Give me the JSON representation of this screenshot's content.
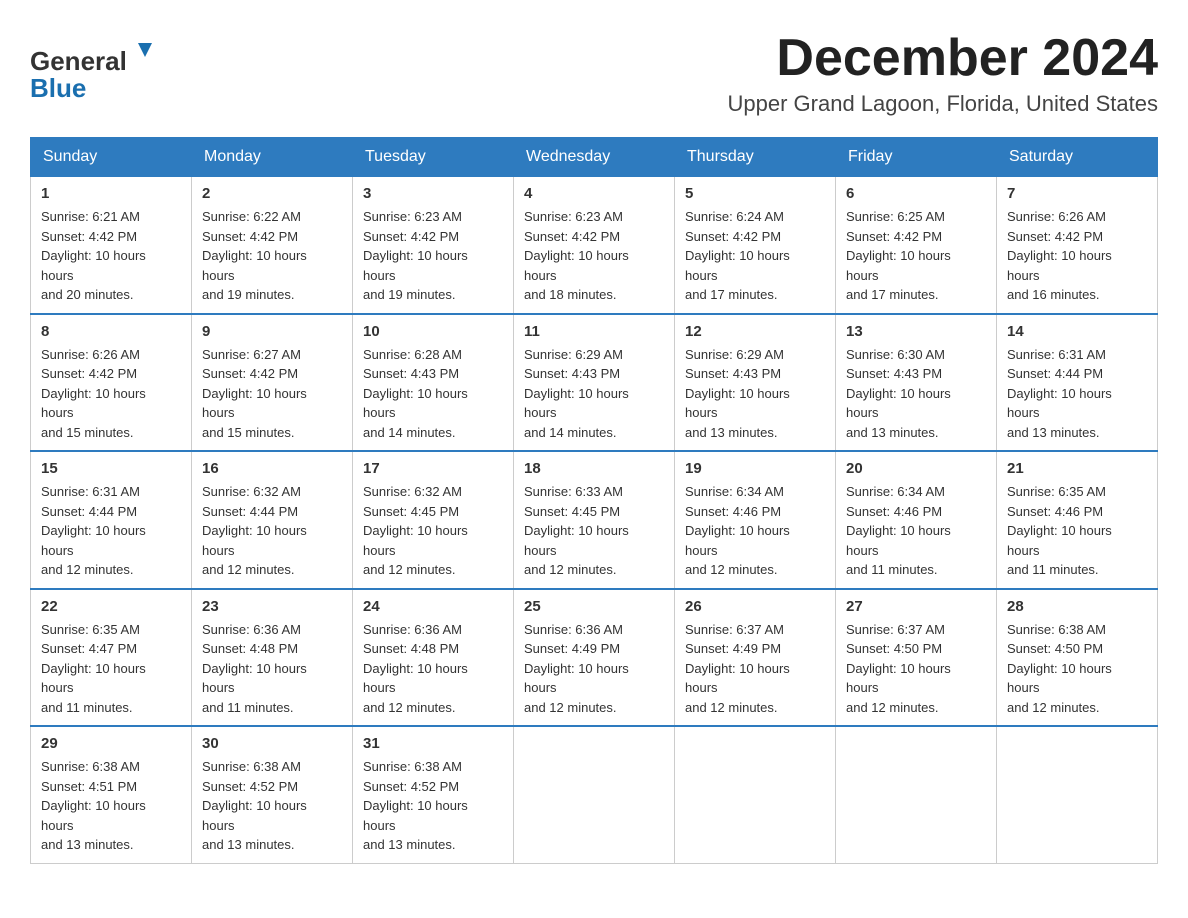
{
  "header": {
    "logo_line1": "General",
    "logo_line2": "Blue",
    "month": "December 2024",
    "location": "Upper Grand Lagoon, Florida, United States"
  },
  "weekdays": [
    "Sunday",
    "Monday",
    "Tuesday",
    "Wednesday",
    "Thursday",
    "Friday",
    "Saturday"
  ],
  "weeks": [
    [
      {
        "day": "1",
        "sunrise": "6:21 AM",
        "sunset": "4:42 PM",
        "daylight": "10 hours and 20 minutes."
      },
      {
        "day": "2",
        "sunrise": "6:22 AM",
        "sunset": "4:42 PM",
        "daylight": "10 hours and 19 minutes."
      },
      {
        "day": "3",
        "sunrise": "6:23 AM",
        "sunset": "4:42 PM",
        "daylight": "10 hours and 19 minutes."
      },
      {
        "day": "4",
        "sunrise": "6:23 AM",
        "sunset": "4:42 PM",
        "daylight": "10 hours and 18 minutes."
      },
      {
        "day": "5",
        "sunrise": "6:24 AM",
        "sunset": "4:42 PM",
        "daylight": "10 hours and 17 minutes."
      },
      {
        "day": "6",
        "sunrise": "6:25 AM",
        "sunset": "4:42 PM",
        "daylight": "10 hours and 17 minutes."
      },
      {
        "day": "7",
        "sunrise": "6:26 AM",
        "sunset": "4:42 PM",
        "daylight": "10 hours and 16 minutes."
      }
    ],
    [
      {
        "day": "8",
        "sunrise": "6:26 AM",
        "sunset": "4:42 PM",
        "daylight": "10 hours and 15 minutes."
      },
      {
        "day": "9",
        "sunrise": "6:27 AM",
        "sunset": "4:42 PM",
        "daylight": "10 hours and 15 minutes."
      },
      {
        "day": "10",
        "sunrise": "6:28 AM",
        "sunset": "4:43 PM",
        "daylight": "10 hours and 14 minutes."
      },
      {
        "day": "11",
        "sunrise": "6:29 AM",
        "sunset": "4:43 PM",
        "daylight": "10 hours and 14 minutes."
      },
      {
        "day": "12",
        "sunrise": "6:29 AM",
        "sunset": "4:43 PM",
        "daylight": "10 hours and 13 minutes."
      },
      {
        "day": "13",
        "sunrise": "6:30 AM",
        "sunset": "4:43 PM",
        "daylight": "10 hours and 13 minutes."
      },
      {
        "day": "14",
        "sunrise": "6:31 AM",
        "sunset": "4:44 PM",
        "daylight": "10 hours and 13 minutes."
      }
    ],
    [
      {
        "day": "15",
        "sunrise": "6:31 AM",
        "sunset": "4:44 PM",
        "daylight": "10 hours and 12 minutes."
      },
      {
        "day": "16",
        "sunrise": "6:32 AM",
        "sunset": "4:44 PM",
        "daylight": "10 hours and 12 minutes."
      },
      {
        "day": "17",
        "sunrise": "6:32 AM",
        "sunset": "4:45 PM",
        "daylight": "10 hours and 12 minutes."
      },
      {
        "day": "18",
        "sunrise": "6:33 AM",
        "sunset": "4:45 PM",
        "daylight": "10 hours and 12 minutes."
      },
      {
        "day": "19",
        "sunrise": "6:34 AM",
        "sunset": "4:46 PM",
        "daylight": "10 hours and 12 minutes."
      },
      {
        "day": "20",
        "sunrise": "6:34 AM",
        "sunset": "4:46 PM",
        "daylight": "10 hours and 11 minutes."
      },
      {
        "day": "21",
        "sunrise": "6:35 AM",
        "sunset": "4:46 PM",
        "daylight": "10 hours and 11 minutes."
      }
    ],
    [
      {
        "day": "22",
        "sunrise": "6:35 AM",
        "sunset": "4:47 PM",
        "daylight": "10 hours and 11 minutes."
      },
      {
        "day": "23",
        "sunrise": "6:36 AM",
        "sunset": "4:48 PM",
        "daylight": "10 hours and 11 minutes."
      },
      {
        "day": "24",
        "sunrise": "6:36 AM",
        "sunset": "4:48 PM",
        "daylight": "10 hours and 12 minutes."
      },
      {
        "day": "25",
        "sunrise": "6:36 AM",
        "sunset": "4:49 PM",
        "daylight": "10 hours and 12 minutes."
      },
      {
        "day": "26",
        "sunrise": "6:37 AM",
        "sunset": "4:49 PM",
        "daylight": "10 hours and 12 minutes."
      },
      {
        "day": "27",
        "sunrise": "6:37 AM",
        "sunset": "4:50 PM",
        "daylight": "10 hours and 12 minutes."
      },
      {
        "day": "28",
        "sunrise": "6:38 AM",
        "sunset": "4:50 PM",
        "daylight": "10 hours and 12 minutes."
      }
    ],
    [
      {
        "day": "29",
        "sunrise": "6:38 AM",
        "sunset": "4:51 PM",
        "daylight": "10 hours and 13 minutes."
      },
      {
        "day": "30",
        "sunrise": "6:38 AM",
        "sunset": "4:52 PM",
        "daylight": "10 hours and 13 minutes."
      },
      {
        "day": "31",
        "sunrise": "6:38 AM",
        "sunset": "4:52 PM",
        "daylight": "10 hours and 13 minutes."
      },
      null,
      null,
      null,
      null
    ]
  ],
  "labels": {
    "sunrise": "Sunrise:",
    "sunset": "Sunset:",
    "daylight": "Daylight:"
  }
}
